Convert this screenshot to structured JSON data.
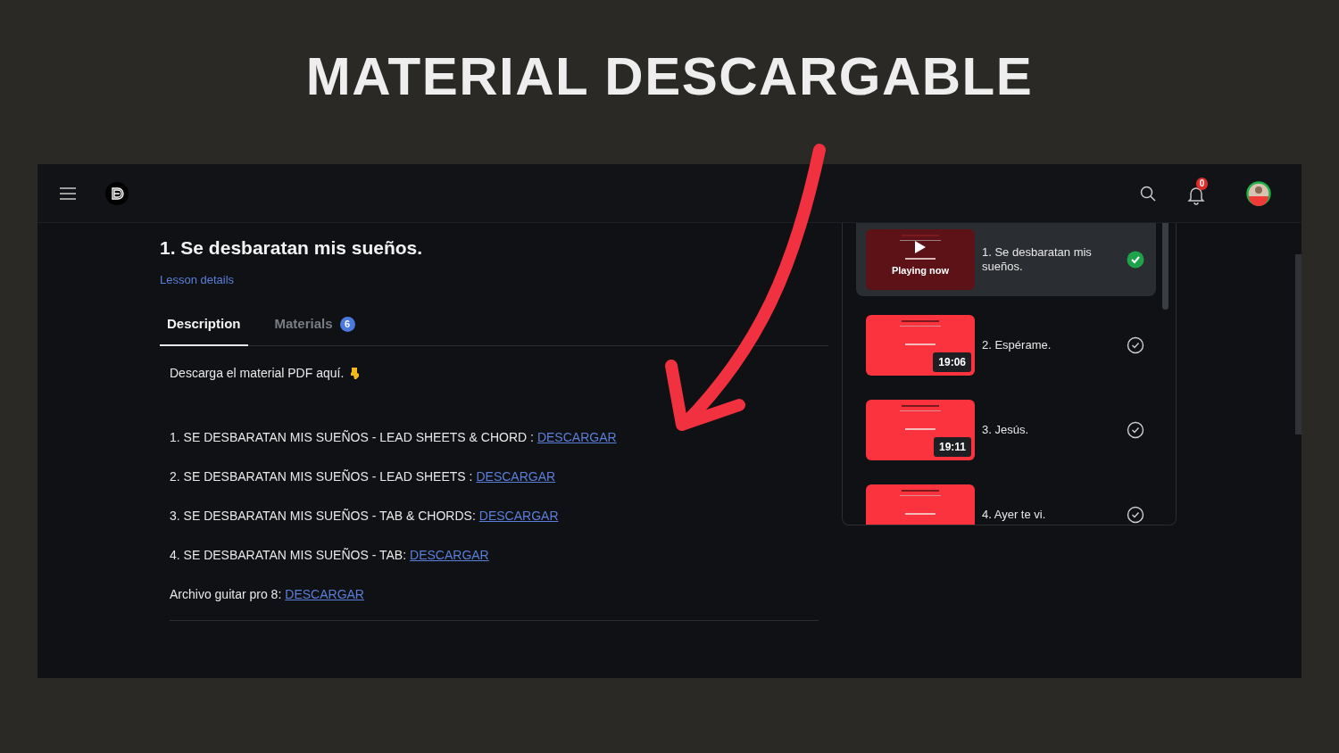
{
  "headline": "MATERIAL DESCARGABLE",
  "top_bar": {
    "notification_count": "0"
  },
  "lesson": {
    "title": "1. Se desbaratan mis sueños.",
    "details_link": "Lesson details",
    "tabs": [
      {
        "label": "Description",
        "selected": true
      },
      {
        "label": "Materials",
        "count": "6",
        "selected": false
      }
    ],
    "description": {
      "intro": "Descarga el material PDF aquí.",
      "items": [
        {
          "text": "1. SE DESBARATAN MIS SUEÑOS - LEAD SHEETS & CHORD :",
          "link": "DESCARGAR"
        },
        {
          "text": "2. SE DESBARATAN MIS SUEÑOS - LEAD SHEETS :",
          "link": "DESCARGAR"
        },
        {
          "text": "3. SE DESBARATAN MIS SUEÑOS - TAB & CHORDS:",
          "link": "DESCARGAR"
        },
        {
          "text": "4. SE DESBARATAN MIS SUEÑOS - TAB:",
          "link": "DESCARGAR"
        },
        {
          "text": "Archivo guitar pro 8:",
          "link": "DESCARGAR"
        }
      ]
    }
  },
  "playlist": [
    {
      "title": "1. Se desbaratan mis sueños.",
      "playing_label": "Playing now",
      "selected": true,
      "completed": true
    },
    {
      "title": "2. Espérame.",
      "duration": "19:06",
      "selected": false,
      "completed": false
    },
    {
      "title": "3. Jesús.",
      "duration": "19:11",
      "selected": false,
      "completed": false
    },
    {
      "title": "4. Ayer te vi.",
      "selected": false,
      "completed": false
    }
  ]
}
